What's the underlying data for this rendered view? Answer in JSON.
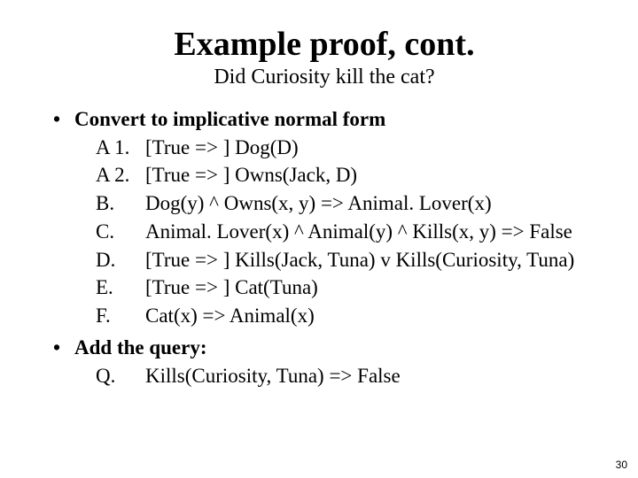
{
  "title": "Example proof, cont.",
  "subtitle": "Did Curiosity kill the cat?",
  "section1": "Convert to implicative normal form",
  "items": [
    {
      "label": "A 1.",
      "text": "[True => ] Dog(D)"
    },
    {
      "label": "A 2.",
      "text": "[True => ] Owns(Jack, D)"
    },
    {
      "label": "B.",
      "text": "Dog(y) ^ Owns(x, y) => Animal. Lover(x)"
    },
    {
      "label": "C.",
      "text": "Animal. Lover(x) ^ Animal(y) ^ Kills(x, y) => False"
    },
    {
      "label": "D.",
      "text": "[True => ] Kills(Jack, Tuna) v Kills(Curiosity, Tuna)"
    },
    {
      "label": "E.",
      "text": "[True => ] Cat(Tuna)"
    },
    {
      "label": "F.",
      "text": "Cat(x) => Animal(x)"
    }
  ],
  "section2": "Add the query:",
  "query": {
    "label": "Q.",
    "text": "Kills(Curiosity, Tuna) => False"
  },
  "page": "30"
}
